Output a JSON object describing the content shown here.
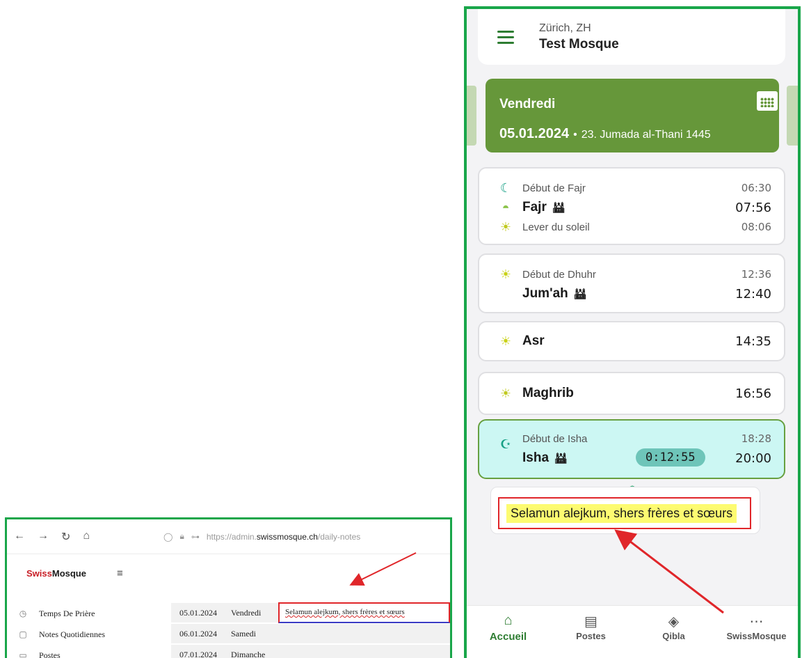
{
  "browser": {
    "url_prefix": "https://admin.",
    "url_host": "swissmosque.ch",
    "url_path": "/daily-notes",
    "brand_part1": "Swiss",
    "brand_part2": "Mosque",
    "sidebar": [
      {
        "label": "Temps De Prière",
        "icon": "clock-icon"
      },
      {
        "label": "Notes Quotidiennes",
        "icon": "note-icon"
      },
      {
        "label": "Postes",
        "icon": "chat-icon"
      }
    ],
    "rows": [
      {
        "date": "05.01.2024",
        "day": "Vendredi",
        "note": "Selamun alejkum, shers frères et sœurs"
      },
      {
        "date": "06.01.2024",
        "day": "Samedi"
      },
      {
        "date": "07.01.2024",
        "day": "Dimanche"
      }
    ]
  },
  "app": {
    "city": "Zürich, ZH",
    "mosque": "Test Mosque",
    "date_card": {
      "day": "Vendredi",
      "date": "05.01.2024",
      "separator": "•",
      "hijri": "23. Jumada al-Thani 1445"
    },
    "fajr": {
      "start_label": "Début de Fajr",
      "start_time": "06:30",
      "name": "Fajr",
      "time": "07:56",
      "sunrise_label": "Lever du soleil",
      "sunrise_time": "08:06"
    },
    "dhuhr": {
      "start_label": "Début de Dhuhr",
      "start_time": "12:36",
      "name": "Jum'ah",
      "time": "12:40"
    },
    "asr": {
      "name": "Asr",
      "time": "14:35"
    },
    "maghrib": {
      "name": "Maghrib",
      "time": "16:56"
    },
    "isha": {
      "start_label": "Début de Isha",
      "start_time": "18:28",
      "name": "Isha",
      "countdown": "0:12:55",
      "time": "20:00"
    },
    "notice": "Selamun alejkum, shers frères et sœurs",
    "nav": [
      {
        "label": "Accueil",
        "icon": "home-icon",
        "active": true
      },
      {
        "label": "Postes",
        "icon": "document-icon",
        "active": false
      },
      {
        "label": "Qibla",
        "icon": "compass-icon",
        "active": false
      },
      {
        "label": "SwissMosque",
        "icon": "more-icon",
        "active": false
      }
    ]
  },
  "colors": {
    "frame_green": "#19a64a",
    "date_card": "#66973a",
    "active_card": "#ccf7f3",
    "highlight": "#fdfb71",
    "annotation_red": "#e0262a"
  }
}
